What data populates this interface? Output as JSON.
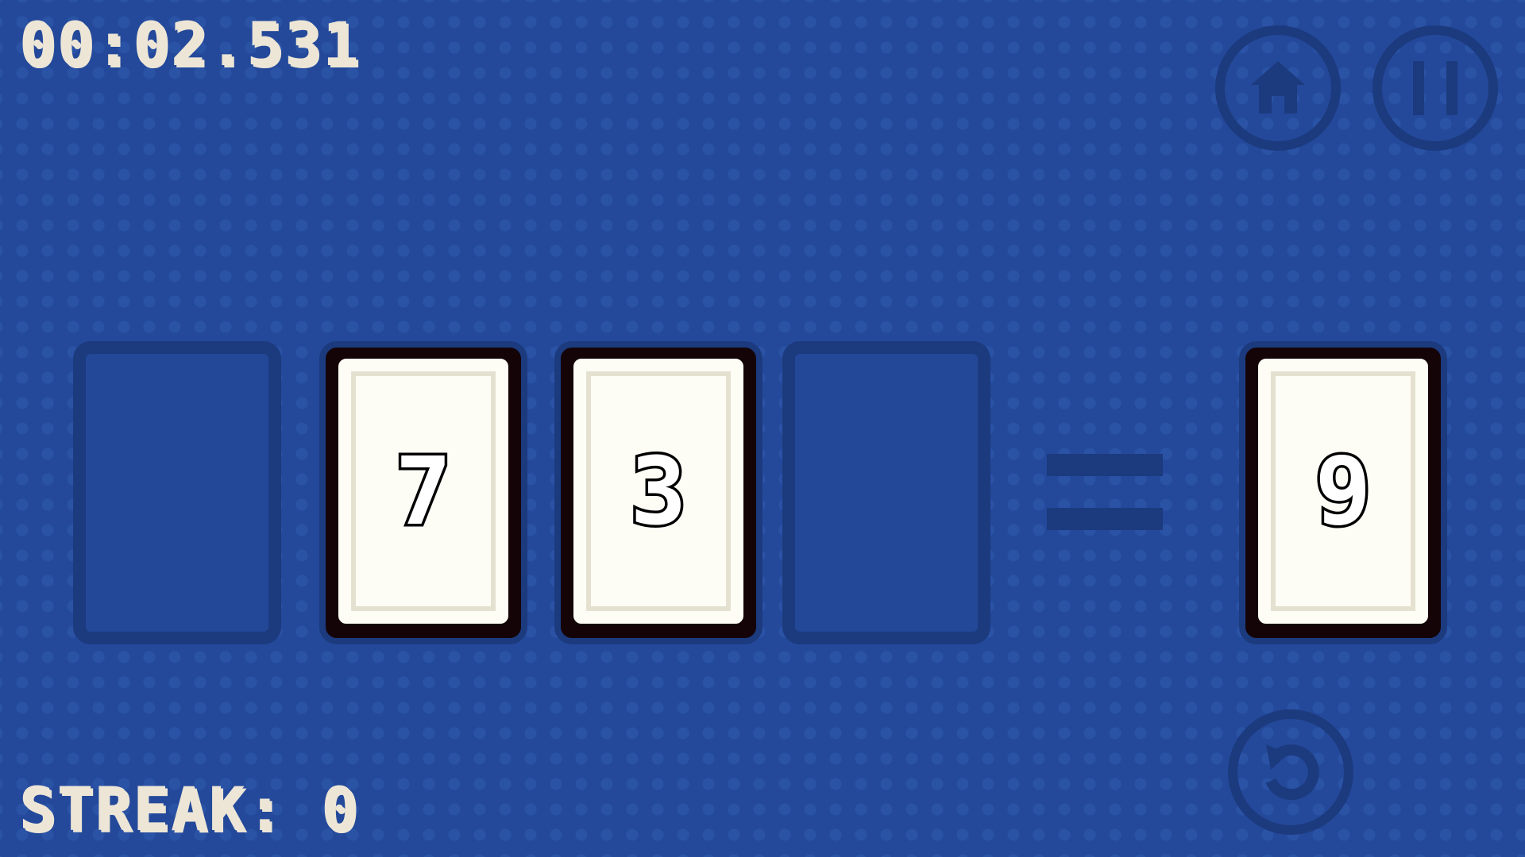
{
  "hud": {
    "timer": "00:02.531",
    "streak_label": "STREAK:",
    "streak_value": "0"
  },
  "buttons": {
    "home_icon": "home-icon",
    "pause_icon": "pause-icon",
    "undo_icon": "undo-icon"
  },
  "cards": {
    "slot1": "",
    "slot2": "7",
    "slot3": "3",
    "slot4": "",
    "result": "9"
  },
  "colors": {
    "background": "#24499a",
    "slot_outline": "#1c3a7e",
    "card_border": "#140407",
    "card_face": "#fdfdf6",
    "hud_text": "#ede6d6"
  }
}
